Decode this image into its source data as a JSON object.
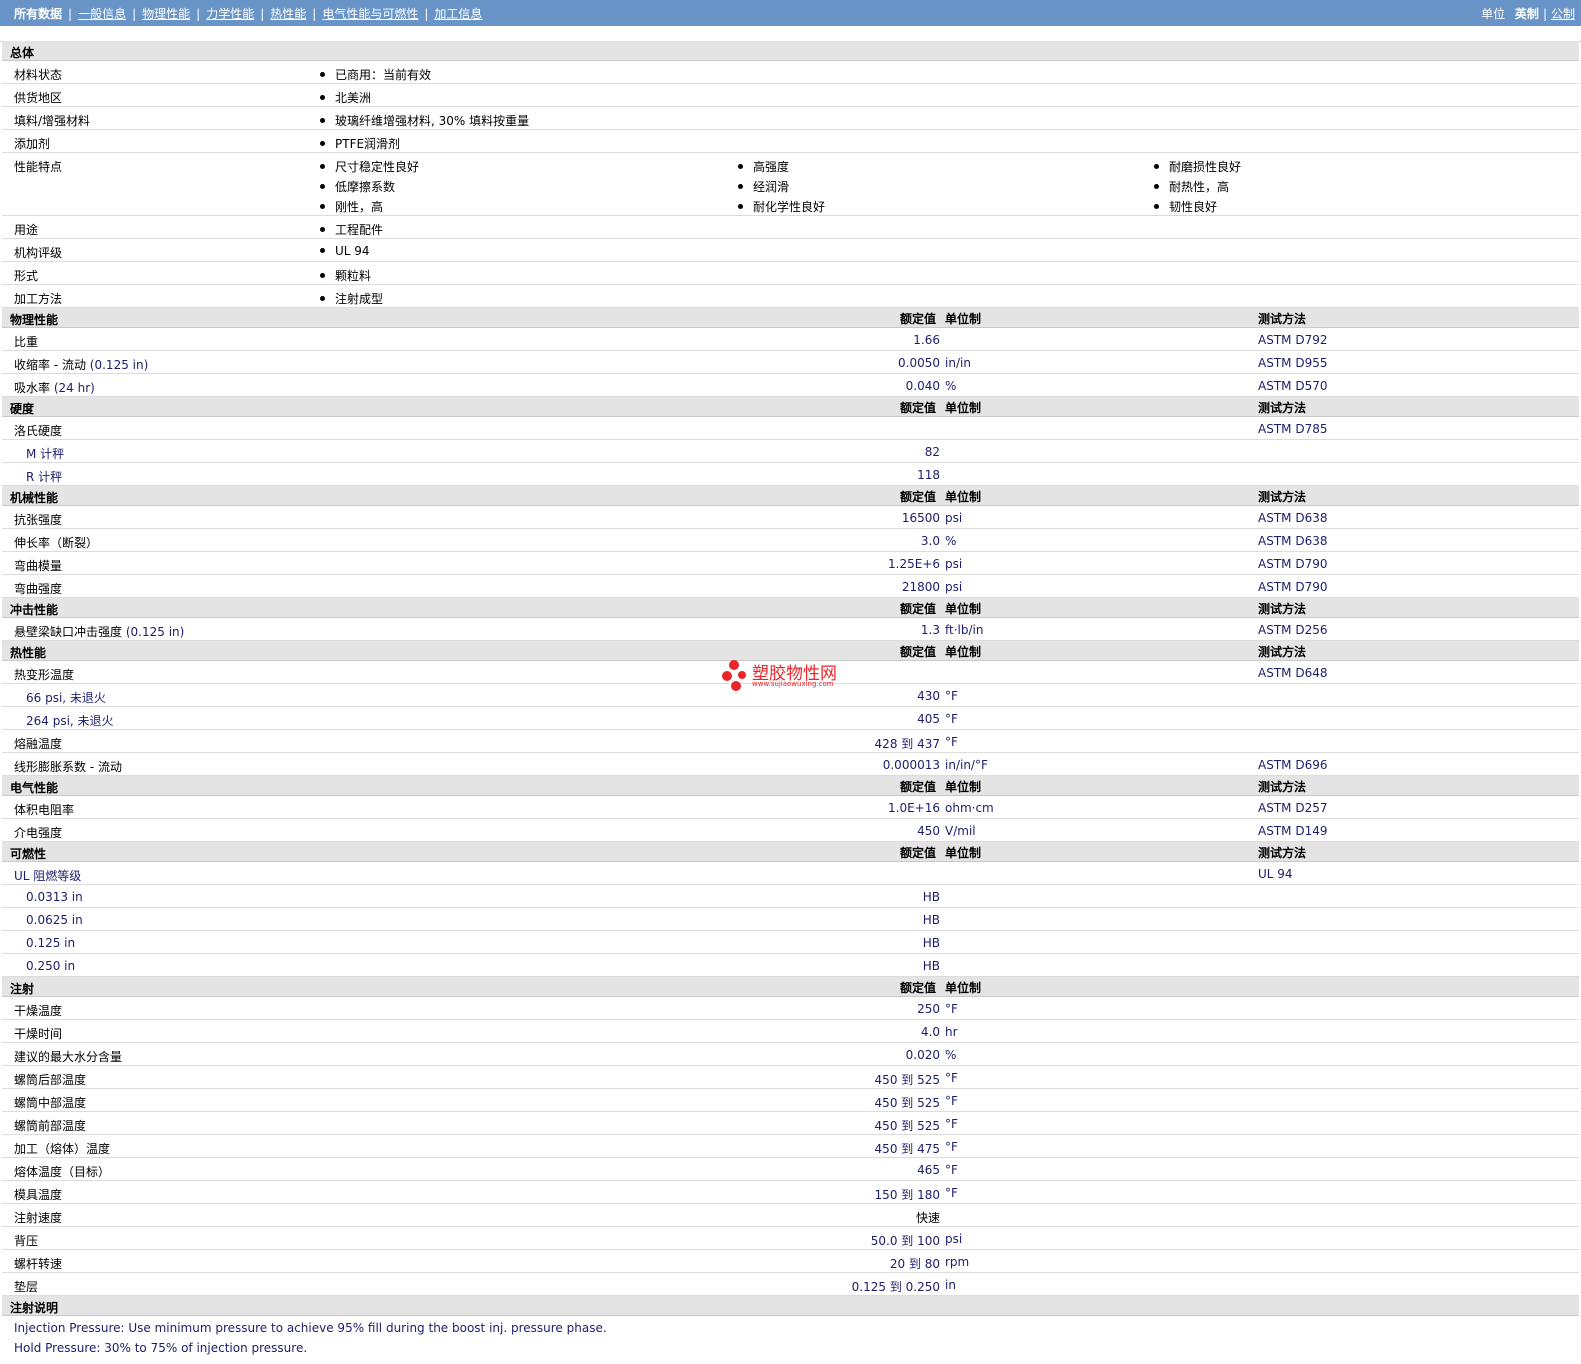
{
  "nav": {
    "tabs": [
      "所有数据",
      "一般信息",
      "物理性能",
      "力学性能",
      "热性能",
      "电气性能与可燃性",
      "加工信息"
    ],
    "unit_label": "单位",
    "unit_imperial": "英制",
    "unit_metric": "公制"
  },
  "headers": {
    "value": "额定值",
    "unit": "单位制",
    "test": "测试方法"
  },
  "general": {
    "title": "总体",
    "rows": [
      {
        "label": "材料状态",
        "items": [
          "已商用：当前有效"
        ]
      },
      {
        "label": "供货地区",
        "items": [
          "北美洲"
        ]
      },
      {
        "label": "填料/增强材料",
        "items": [
          "玻璃纤维增强材料, 30% 填料按重量"
        ]
      },
      {
        "label": "添加剂",
        "items": [
          "PTFE润滑剂"
        ]
      }
    ],
    "features": {
      "label": "性能特点",
      "col1": [
        "尺寸稳定性良好",
        "低摩擦系数",
        "刚性，高"
      ],
      "col2": [
        "高强度",
        "经润滑",
        "耐化学性良好"
      ],
      "col3": [
        "耐磨损性良好",
        "耐热性，高",
        "韧性良好"
      ]
    },
    "rows2": [
      {
        "label": "用途",
        "items": [
          "工程配件"
        ]
      },
      {
        "label": "机构评级",
        "items": [
          "UL 94"
        ]
      },
      {
        "label": "形式",
        "items": [
          "颗粒料"
        ]
      },
      {
        "label": "加工方法",
        "items": [
          "注射成型"
        ]
      }
    ]
  },
  "sections": [
    {
      "title": "物理性能",
      "rows": [
        {
          "label": "比重",
          "value": "1.66",
          "unit": "",
          "test": "ASTM D792"
        },
        {
          "label": "收缩率 - 流动",
          "cond": "(0.125 in)",
          "value": "0.0050",
          "unit": "in/in",
          "test": "ASTM D955"
        },
        {
          "label": "吸水率",
          "cond": "(24 hr)",
          "value": "0.040",
          "unit": "%",
          "test": "ASTM D570"
        }
      ]
    },
    {
      "title": "硬度",
      "rows": [
        {
          "label": "洛氏硬度",
          "value": "",
          "unit": "",
          "test": "ASTM D785"
        },
        {
          "label": "M 计秤",
          "sub": true,
          "value": "82",
          "unit": "",
          "test": ""
        },
        {
          "label": "R 计秤",
          "sub": true,
          "value": "118",
          "unit": "",
          "test": ""
        }
      ]
    },
    {
      "title": "机械性能",
      "rows": [
        {
          "label": "抗张强度",
          "value": "16500",
          "unit": "psi",
          "test": "ASTM D638"
        },
        {
          "label": "伸长率（断裂）",
          "value": "3.0",
          "unit": "%",
          "test": "ASTM D638"
        },
        {
          "label": "弯曲模量",
          "value": "1.25E+6",
          "unit": "psi",
          "test": "ASTM D790"
        },
        {
          "label": "弯曲强度",
          "value": "21800",
          "unit": "psi",
          "test": "ASTM D790"
        }
      ]
    },
    {
      "title": "冲击性能",
      "rows": [
        {
          "label": "悬壁梁缺口冲击强度",
          "cond": "(0.125 in)",
          "value": "1.3",
          "unit": "ft·lb/in",
          "test": "ASTM D256"
        }
      ]
    },
    {
      "title": "热性能",
      "rows": [
        {
          "label": "热变形温度",
          "value": "",
          "unit": "",
          "test": "ASTM D648"
        },
        {
          "label": "66 psi, 未退火",
          "sub": true,
          "value": "430",
          "unit": "°F",
          "test": ""
        },
        {
          "label": "264 psi, 未退火",
          "sub": true,
          "value": "405",
          "unit": "°F",
          "test": ""
        },
        {
          "label": "熔融温度",
          "value": "428 到  437",
          "unit": "°F",
          "test": ""
        },
        {
          "label": "线形膨胀系数 - 流动",
          "value": "0.000013",
          "unit": "in/in/°F",
          "test": "ASTM D696"
        }
      ]
    },
    {
      "title": "电气性能",
      "rows": [
        {
          "label": "体积电阻率",
          "value": "1.0E+16",
          "unit": "ohm·cm",
          "test": "ASTM D257"
        },
        {
          "label": "介电强度",
          "value": "450",
          "unit": "V/mil",
          "test": "ASTM D149"
        }
      ]
    },
    {
      "title": "可燃性",
      "rows": [
        {
          "label": "UL 阻燃等级",
          "value": "",
          "unit": "",
          "test": "UL 94",
          "blue": true
        },
        {
          "label": "0.0313 in",
          "sub": true,
          "value": "HB",
          "unit": "",
          "test": ""
        },
        {
          "label": "0.0625 in",
          "sub": true,
          "value": "HB",
          "unit": "",
          "test": ""
        },
        {
          "label": "0.125 in",
          "sub": true,
          "value": "HB",
          "unit": "",
          "test": ""
        },
        {
          "label": "0.250 in",
          "sub": true,
          "value": "HB",
          "unit": "",
          "test": ""
        }
      ]
    },
    {
      "title": "注射",
      "notest": true,
      "rows": [
        {
          "label": "干燥温度",
          "value": "250",
          "unit": "°F",
          "test": ""
        },
        {
          "label": "干燥时间",
          "value": "4.0",
          "unit": "hr",
          "test": ""
        },
        {
          "label": "建议的最大水分含量",
          "value": "0.020",
          "unit": "%",
          "test": ""
        },
        {
          "label": "螺筒后部温度",
          "value": "450 到  525",
          "unit": "°F",
          "test": ""
        },
        {
          "label": "螺筒中部温度",
          "value": "450 到  525",
          "unit": "°F",
          "test": ""
        },
        {
          "label": "螺筒前部温度",
          "value": "450 到  525",
          "unit": "°F",
          "test": ""
        },
        {
          "label": "加工（熔体）温度",
          "value": "450 到  475",
          "unit": "°F",
          "test": ""
        },
        {
          "label": "熔体温度（目标）",
          "value": "465",
          "unit": "°F",
          "test": ""
        },
        {
          "label": "模具温度",
          "value": "150 到  180",
          "unit": "°F",
          "test": ""
        },
        {
          "label": "注射速度",
          "value": "快速",
          "unit": "",
          "test": "",
          "black": true
        },
        {
          "label": "背压",
          "value": "50.0 到  100",
          "unit": "psi",
          "test": ""
        },
        {
          "label": "螺杆转速",
          "value": "20 到  80",
          "unit": "rpm",
          "test": ""
        },
        {
          "label": "垫层",
          "value": "0.125 到  0.250",
          "unit": "in",
          "test": ""
        }
      ]
    }
  ],
  "notes": {
    "title": "注射说明",
    "lines": [
      "Injection Pressure: Use minimum pressure to achieve 95% fill during the boost inj. pressure phase.",
      "Hold Pressure: 30% to 75% of injection pressure."
    ]
  },
  "watermark": {
    "text": "塑胶物性网",
    "url": "www.sujiaowuxing.com",
    "icon": "red-dots-logo"
  }
}
